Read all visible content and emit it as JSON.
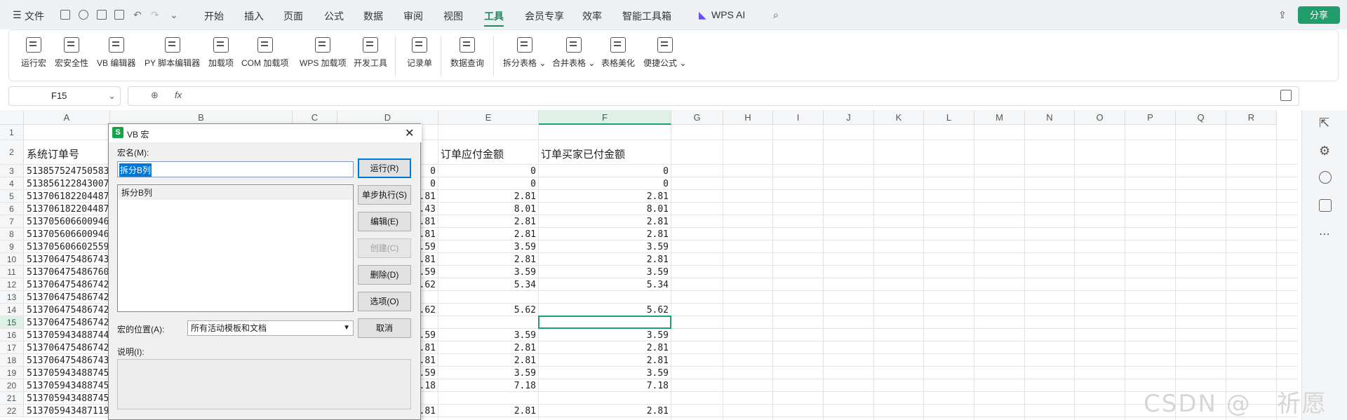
{
  "topbar": {
    "file": "文件",
    "tabs": [
      "开始",
      "插入",
      "页面",
      "公式",
      "数据",
      "审阅",
      "视图",
      "工具",
      "会员专享",
      "效率",
      "智能工具箱",
      "WPS AI"
    ],
    "active_tab": "工具",
    "share": "分享"
  },
  "ribbon": {
    "items": [
      "运行宏",
      "宏安全性",
      "VB 编辑器",
      "PY 脚本编辑器",
      "加载项",
      "COM 加载项",
      "WPS 加载项",
      "开发工具",
      "记录单",
      "数据查询",
      "拆分表格",
      "合并表格",
      "表格美化",
      "便捷公式"
    ]
  },
  "formula_bar": {
    "cell_ref": "F15",
    "fx": "fx",
    "value": ""
  },
  "grid": {
    "columns": [
      "A",
      "B",
      "C",
      "D",
      "E",
      "F",
      "G",
      "H",
      "I",
      "J",
      "K",
      "L",
      "M",
      "N",
      "O",
      "P",
      "Q",
      "R"
    ],
    "rows": [
      "1",
      "2",
      "3",
      "4",
      "5",
      "6",
      "7",
      "8",
      "9",
      "10",
      "11",
      "12",
      "13",
      "14",
      "15",
      "16",
      "17",
      "18",
      "19",
      "20",
      "21",
      "22"
    ],
    "headers": {
      "a": "系统订单号",
      "e": "订单应付金额",
      "f": "订单买家已付金额"
    },
    "col_a": [
      "",
      "",
      "513857524750583",
      "513856122843007",
      "513706182204487",
      "513706182204487",
      "513705606600946",
      "513705606600946",
      "513705606602559",
      "513706475486743",
      "513706475486760",
      "513706475486742",
      "513706475486742",
      "513706475486742",
      "513706475486742",
      "513705943488744",
      "513706475486742",
      "513706475486743",
      "513705943488745",
      "513705943488745",
      "513705943488745",
      "513705943487119"
    ],
    "col_d": [
      "",
      "",
      "0",
      "0",
      ".81",
      ".43",
      ".81",
      ".81",
      ".59",
      ".81",
      ".59",
      ".62",
      "",
      ".62",
      "",
      ".59",
      ".81",
      ".81",
      ".59",
      ".18",
      "",
      ".81"
    ],
    "col_e": [
      "",
      "",
      "0",
      "0",
      "2.81",
      "8.01",
      "2.81",
      "2.81",
      "3.59",
      "2.81",
      "3.59",
      "5.34",
      "",
      "5.62",
      "",
      "3.59",
      "2.81",
      "2.81",
      "3.59",
      "7.18",
      "",
      "2.81"
    ],
    "col_f": [
      "",
      "",
      "0",
      "0",
      "2.81",
      "8.01",
      "2.81",
      "2.81",
      "3.59",
      "2.81",
      "3.59",
      "5.34",
      "",
      "5.62",
      "",
      "3.59",
      "2.81",
      "2.81",
      "3.59",
      "7.18",
      "",
      "2.81"
    ]
  },
  "dialog": {
    "title": "VB 宏",
    "macro_name_label": "宏名(M):",
    "macro_name_value": "拆分B列",
    "macros": [
      "拆分B列"
    ],
    "buttons": {
      "run": "运行(R)",
      "step": "单步执行(S)",
      "edit": "编辑(E)",
      "create": "创建(C)",
      "delete": "删除(D)",
      "options": "选项(O)",
      "cancel": "取消"
    },
    "location_label": "宏的位置(A):",
    "location_value": "所有活动模板和文档",
    "description_label": "说明(I):"
  },
  "watermark": "CSDN @　祈愿"
}
